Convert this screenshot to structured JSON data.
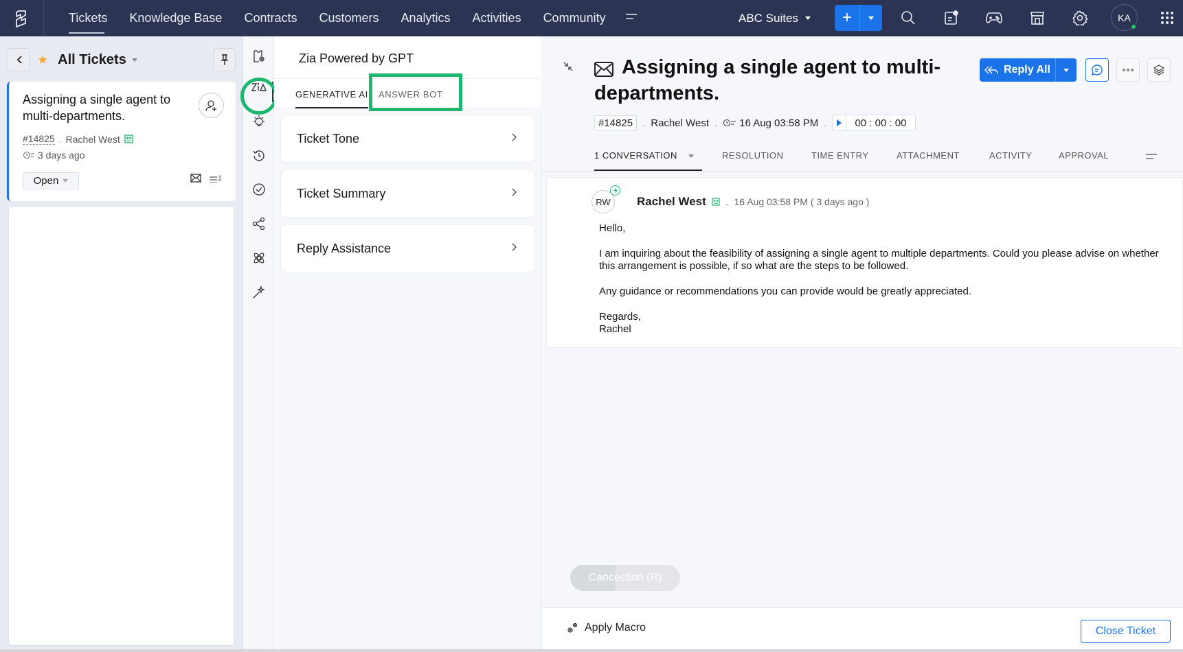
{
  "topnav": {
    "items": [
      {
        "label": "Tickets",
        "active": true
      },
      {
        "label": "Knowledge Base"
      },
      {
        "label": "Contracts"
      },
      {
        "label": "Customers"
      },
      {
        "label": "Analytics"
      },
      {
        "label": "Activities"
      },
      {
        "label": "Community"
      }
    ],
    "org_name": "ABC Suites",
    "user_initials": "KA",
    "icons": [
      "desk-logo-icon",
      "more-menu-icon",
      "add-icon",
      "search-icon",
      "notifications-icon",
      "gamescope-icon",
      "marketplace-icon",
      "settings-icon",
      "apps-grid-icon"
    ]
  },
  "left_panel": {
    "view_title": "All Tickets",
    "ticket": {
      "subject": "Assigning a single agent to multi-departments.",
      "id": "#14825",
      "contact": "Rachel West",
      "age": "3 days ago",
      "status": "Open",
      "thread_count": "1"
    }
  },
  "rail": {
    "icons": [
      "ticket-settings-icon",
      "zia-icon",
      "bulb-icon",
      "history-icon",
      "check-circle-icon",
      "share-icon",
      "atom-icon",
      "magic-wand-icon"
    ]
  },
  "zia_panel": {
    "title": "Zia Powered by GPT",
    "tabs": [
      {
        "label": "GENERATIVE AI",
        "active": true
      },
      {
        "label": "ANSWER BOT",
        "active": false
      }
    ],
    "items": [
      {
        "label": "Ticket Tone"
      },
      {
        "label": "Ticket Summary"
      },
      {
        "label": "Reply Assistance"
      }
    ]
  },
  "ticket": {
    "title": "Assigning a single agent to multi-departments.",
    "id": "#14825",
    "contact": "Rachel West",
    "created": "16 Aug 03:58 PM",
    "timer": "00 : 00 : 00",
    "reply_label": "Reply All",
    "tabs": [
      {
        "label": "1 CONVERSATION",
        "active": true
      },
      {
        "label": "RESOLUTION"
      },
      {
        "label": "TIME ENTRY"
      },
      {
        "label": "ATTACHMENT"
      },
      {
        "label": "ACTIVITY"
      },
      {
        "label": "APPROVAL"
      }
    ],
    "conversation": {
      "avatar_initials": "RW",
      "sender": "Rachel West",
      "timestamp": "16 Aug 03:58 PM ( 3 days ago )",
      "body": [
        "Hello,",
        "I am inquiring about the feasibility of assigning a single agent to multiple departments. Could you please advise on whether this arrangement is possible, if so what are the steps to be followed.",
        "Any guidance or recommendations you can provide would be greatly appreciated.",
        "Regards,\nRachel"
      ]
    },
    "floating_button": "Cancection (R)",
    "apply_macro": "Apply Macro",
    "close_ticket": "Close Ticket"
  },
  "colors": {
    "nav_bg": "#2b3452",
    "accent": "#1a73e8",
    "highlight": "#21b66f",
    "star": "#f4a93a"
  }
}
